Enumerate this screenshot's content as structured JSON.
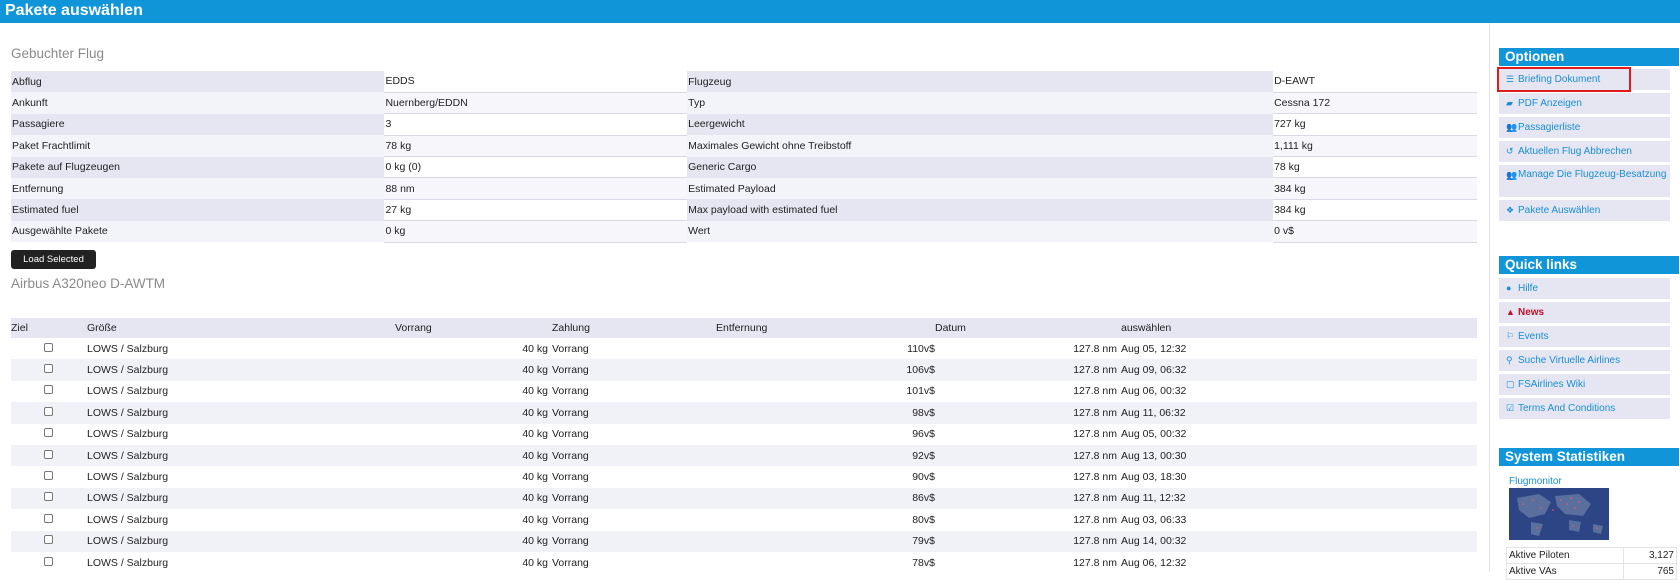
{
  "page": {
    "title": "Pakete auswählen"
  },
  "booked_flight": {
    "title": "Gebuchter Flug",
    "rows": [
      {
        "l1": "Abflug",
        "v1": "EDDS",
        "l2": "Flugzeug",
        "v2": "D-EAWT"
      },
      {
        "l1": "Ankunft",
        "v1": "Nuernberg/EDDN",
        "l2": "Typ",
        "v2": "Cessna 172"
      },
      {
        "l1": "Passagiere",
        "v1": "3",
        "l2": "Leergewicht",
        "v2": "727 kg"
      },
      {
        "l1": "Paket Frachtlimit",
        "v1": "78 kg",
        "l2": "Maximales Gewicht ohne Treibstoff",
        "v2": "1,111 kg"
      },
      {
        "l1": "Pakete auf Flugzeugen",
        "v1": "0 kg (0)",
        "l2": "Generic Cargo",
        "v2": "78 kg"
      },
      {
        "l1": "Entfernung",
        "v1": "88 nm",
        "l2": "Estimated Payload",
        "v2": "384 kg"
      },
      {
        "l1": "Estimated fuel",
        "v1": "27 kg",
        "l2": "Max payload with estimated fuel",
        "v2": "384 kg"
      },
      {
        "l1": "Ausgewählte Pakete",
        "v1": "0 kg",
        "l2": "Wert",
        "v2": "0 v$"
      }
    ],
    "load_button": "Load Selected"
  },
  "aircraft": {
    "title": "Airbus A320neo D-AWTM",
    "columns": [
      "Ziel",
      "Größe",
      "Vorrang",
      "Zahlung",
      "Entfernung",
      "Datum",
      "auswählen"
    ],
    "rows": [
      {
        "dest": "LOWS / Salzburg",
        "size": "40 kg",
        "priority": "Vorrang",
        "pay": "110v$",
        "dist": "127.8 nm",
        "date": "Aug 05, 12:32"
      },
      {
        "dest": "LOWS / Salzburg",
        "size": "40 kg",
        "priority": "Vorrang",
        "pay": "106v$",
        "dist": "127.8 nm",
        "date": "Aug 09, 06:32"
      },
      {
        "dest": "LOWS / Salzburg",
        "size": "40 kg",
        "priority": "Vorrang",
        "pay": "101v$",
        "dist": "127.8 nm",
        "date": "Aug 06, 00:32"
      },
      {
        "dest": "LOWS / Salzburg",
        "size": "40 kg",
        "priority": "Vorrang",
        "pay": "98v$",
        "dist": "127.8 nm",
        "date": "Aug 11, 06:32"
      },
      {
        "dest": "LOWS / Salzburg",
        "size": "40 kg",
        "priority": "Vorrang",
        "pay": "96v$",
        "dist": "127.8 nm",
        "date": "Aug 05, 00:32"
      },
      {
        "dest": "LOWS / Salzburg",
        "size": "40 kg",
        "priority": "Vorrang",
        "pay": "92v$",
        "dist": "127.8 nm",
        "date": "Aug 13, 00:30"
      },
      {
        "dest": "LOWS / Salzburg",
        "size": "40 kg",
        "priority": "Vorrang",
        "pay": "90v$",
        "dist": "127.8 nm",
        "date": "Aug 03, 18:30"
      },
      {
        "dest": "LOWS / Salzburg",
        "size": "40 kg",
        "priority": "Vorrang",
        "pay": "86v$",
        "dist": "127.8 nm",
        "date": "Aug 11, 12:32"
      },
      {
        "dest": "LOWS / Salzburg",
        "size": "40 kg",
        "priority": "Vorrang",
        "pay": "80v$",
        "dist": "127.8 nm",
        "date": "Aug 03, 06:33"
      },
      {
        "dest": "LOWS / Salzburg",
        "size": "40 kg",
        "priority": "Vorrang",
        "pay": "79v$",
        "dist": "127.8 nm",
        "date": "Aug 14, 00:32"
      },
      {
        "dest": "LOWS / Salzburg",
        "size": "40 kg",
        "priority": "Vorrang",
        "pay": "78v$",
        "dist": "127.8 nm",
        "date": "Aug 06, 12:32"
      }
    ]
  },
  "sidebar": {
    "options": {
      "title": "Optionen",
      "items": [
        {
          "label": "Briefing Dokument",
          "icon": "list-icon"
        },
        {
          "label": "PDF Anzeigen",
          "icon": "folder-icon"
        },
        {
          "label": "Passagierliste",
          "icon": "users-icon"
        },
        {
          "label": "Aktuellen Flug Abbrechen",
          "icon": "undo-icon"
        },
        {
          "label": "Manage Die Flugzeug-Besatzung",
          "icon": "users-icon"
        },
        {
          "label": "Pakete Auswählen",
          "icon": "dropbox-icon"
        }
      ]
    },
    "quick_links": {
      "title": "Quick links",
      "items": [
        {
          "label": "Hilfe",
          "icon": "info-icon"
        },
        {
          "label": "News",
          "icon": "warning-icon"
        },
        {
          "label": "Events",
          "icon": "flag-icon"
        },
        {
          "label": "Suche Virtuelle Airlines",
          "icon": "search-icon"
        },
        {
          "label": "FSAirlines Wiki",
          "icon": "document-icon"
        },
        {
          "label": "Terms And Conditions",
          "icon": "checkbox-icon"
        }
      ]
    },
    "stats": {
      "title": "System Statistiken",
      "monitor_label": "Flugmonitor",
      "rows": [
        {
          "label": "Aktive Piloten",
          "value": "3,127"
        },
        {
          "label": "Aktive VAs",
          "value": "765"
        }
      ]
    }
  },
  "colors": {
    "accent": "#1195d9",
    "news": "#c0102a",
    "highlight": "#e01b1b",
    "row": "#e6e6f3"
  }
}
